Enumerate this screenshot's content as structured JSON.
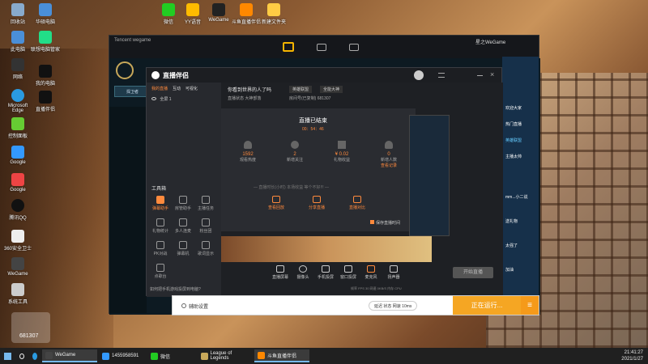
{
  "desktop": {
    "icons_left": [
      "回收站",
      "华硕电脑",
      "此电脑",
      "联想电脑管家",
      "网络",
      "我的电脑",
      "Microsoft Edge",
      "直播伴侣",
      "控制面板",
      "Google",
      "腾讯QQ",
      "360安全卫士",
      "WeGame",
      "系统工具",
      "QQ"
    ],
    "icons_top": [
      "微信",
      "YY语音",
      "WeGame",
      "斗鱼直播伴侣",
      "新建文件夹"
    ],
    "watermark_text": "681307"
  },
  "wegame": {
    "title": "Tencent wegame",
    "user": "星之WeGame",
    "game_tab": "LOL",
    "side_label": "捍卫者"
  },
  "zbb": {
    "app_name": "直播伴侣",
    "tabs": [
      "我的直播",
      "互动",
      "可视化"
    ],
    "scene": "全屏 1",
    "room_title": "你看到世界的人了吗",
    "category": "英雄联盟",
    "fan_btn": "全能大神",
    "room_status": "直播状态 大神部落",
    "room_id": "房间号(已复制) 681307",
    "tools_title": "工具箱",
    "tools": [
      "弹幕助手",
      "房管助手",
      "主播任务",
      "粉丝团",
      "礼物统计",
      "多人连麦",
      "PK对战",
      "弹幕机",
      "歌词显示",
      "点歌台",
      "分享直播",
      "更多"
    ],
    "ended_title": "直播已结束",
    "ended_time": "00：54：46",
    "stats": [
      {
        "value": "1592",
        "label": "观看热度"
      },
      {
        "value": "2",
        "label": "新增关注"
      },
      {
        "value": "¥ 0.02",
        "label": "礼物收益"
      },
      {
        "value": "0",
        "label": "新增人数"
      }
    ],
    "stat_link": "查看记录",
    "ended_note": "— 直播时长(小时) 本场收益 等个不好!!! —",
    "ended_actions": [
      "查看回放",
      "分享直播",
      "直播对比"
    ],
    "save_record": "保存直播时间",
    "bottom_tools": [
      "直播屏幕",
      "摄像头",
      "手机投屏",
      "窗口投屏",
      "麦克风",
      "扬声器"
    ],
    "start_btn": "开始直播",
    "notice": "如何把手机游戏投屏到电脑?",
    "footer_info": "帧率 FPS 30 网速 0KB/S 内存 CPU"
  },
  "statusbar": {
    "settings_btn": "辅助设置",
    "net_text": "延迟 状态 网速 10ms",
    "running": "正在运行..."
  },
  "chat": {
    "lines": [
      "欢迎大家",
      "热门直播",
      "英雄联盟",
      "主播太帅",
      "mm...小二说",
      "送礼物",
      "太强了",
      "加油"
    ]
  },
  "taskbar": {
    "items": [
      "WeGame",
      "1455958591",
      "微信",
      "League of Legends",
      "斗鱼直播伴侣"
    ],
    "time": "21:41:27",
    "date": "2021/1/27"
  }
}
